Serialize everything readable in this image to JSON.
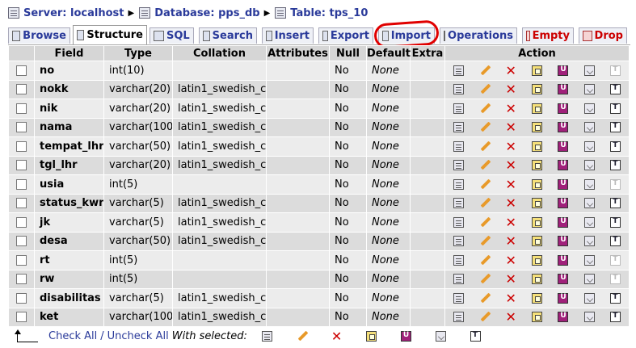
{
  "breadcrumb": {
    "server_label": "Server: localhost",
    "database_label": "Database: pps_db",
    "table_label": "Table: tps_10"
  },
  "tabs": [
    {
      "label": "Browse",
      "icon": "browse-icon"
    },
    {
      "label": "Structure",
      "icon": "structure-icon",
      "active": true
    },
    {
      "label": "SQL",
      "icon": "sql-icon"
    },
    {
      "label": "Search",
      "icon": "search-icon"
    },
    {
      "label": "Insert",
      "icon": "insert-icon"
    },
    {
      "label": "Export",
      "icon": "export-icon"
    },
    {
      "label": "Import",
      "icon": "import-icon"
    },
    {
      "label": "Operations",
      "icon": "operations-icon"
    },
    {
      "label": "Empty",
      "icon": "empty-icon"
    },
    {
      "label": "Drop",
      "icon": "drop-icon"
    }
  ],
  "table": {
    "headers": {
      "field": "Field",
      "type": "Type",
      "collation": "Collation",
      "attributes": "Attributes",
      "null": "Null",
      "default": "Default",
      "extra": "Extra",
      "action": "Action"
    },
    "rows": [
      {
        "field": "no",
        "type": "int(10)",
        "collation": "",
        "attributes": "",
        "null": "No",
        "default": "None",
        "extra": ""
      },
      {
        "field": "nokk",
        "type": "varchar(20)",
        "collation": "latin1_swedish_ci",
        "attributes": "",
        "null": "No",
        "default": "None",
        "extra": ""
      },
      {
        "field": "nik",
        "type": "varchar(20)",
        "collation": "latin1_swedish_ci",
        "attributes": "",
        "null": "No",
        "default": "None",
        "extra": ""
      },
      {
        "field": "nama",
        "type": "varchar(100)",
        "collation": "latin1_swedish_ci",
        "attributes": "",
        "null": "No",
        "default": "None",
        "extra": ""
      },
      {
        "field": "tempat_lhr",
        "type": "varchar(50)",
        "collation": "latin1_swedish_ci",
        "attributes": "",
        "null": "No",
        "default": "None",
        "extra": ""
      },
      {
        "field": "tgl_lhr",
        "type": "varchar(20)",
        "collation": "latin1_swedish_ci",
        "attributes": "",
        "null": "No",
        "default": "None",
        "extra": ""
      },
      {
        "field": "usia",
        "type": "int(5)",
        "collation": "",
        "attributes": "",
        "null": "No",
        "default": "None",
        "extra": ""
      },
      {
        "field": "status_kwn",
        "type": "varchar(5)",
        "collation": "latin1_swedish_ci",
        "attributes": "",
        "null": "No",
        "default": "None",
        "extra": ""
      },
      {
        "field": "jk",
        "type": "varchar(5)",
        "collation": "latin1_swedish_ci",
        "attributes": "",
        "null": "No",
        "default": "None",
        "extra": ""
      },
      {
        "field": "desa",
        "type": "varchar(50)",
        "collation": "latin1_swedish_ci",
        "attributes": "",
        "null": "No",
        "default": "None",
        "extra": ""
      },
      {
        "field": "rt",
        "type": "int(5)",
        "collation": "",
        "attributes": "",
        "null": "No",
        "default": "None",
        "extra": ""
      },
      {
        "field": "rw",
        "type": "int(5)",
        "collation": "",
        "attributes": "",
        "null": "No",
        "default": "None",
        "extra": ""
      },
      {
        "field": "disabilitas",
        "type": "varchar(5)",
        "collation": "latin1_swedish_ci",
        "attributes": "",
        "null": "No",
        "default": "None",
        "extra": ""
      },
      {
        "field": "ket",
        "type": "varchar(100)",
        "collation": "latin1_swedish_ci",
        "attributes": "",
        "null": "No",
        "default": "None",
        "extra": ""
      }
    ]
  },
  "footer": {
    "check_all": "Check All",
    "separator": "/",
    "uncheck_all": "Uncheck All",
    "with_selected": "With selected:"
  },
  "colors": {
    "link": "#2a3a9a",
    "annotation_circle": "#e00000",
    "danger": "#cc0000"
  }
}
